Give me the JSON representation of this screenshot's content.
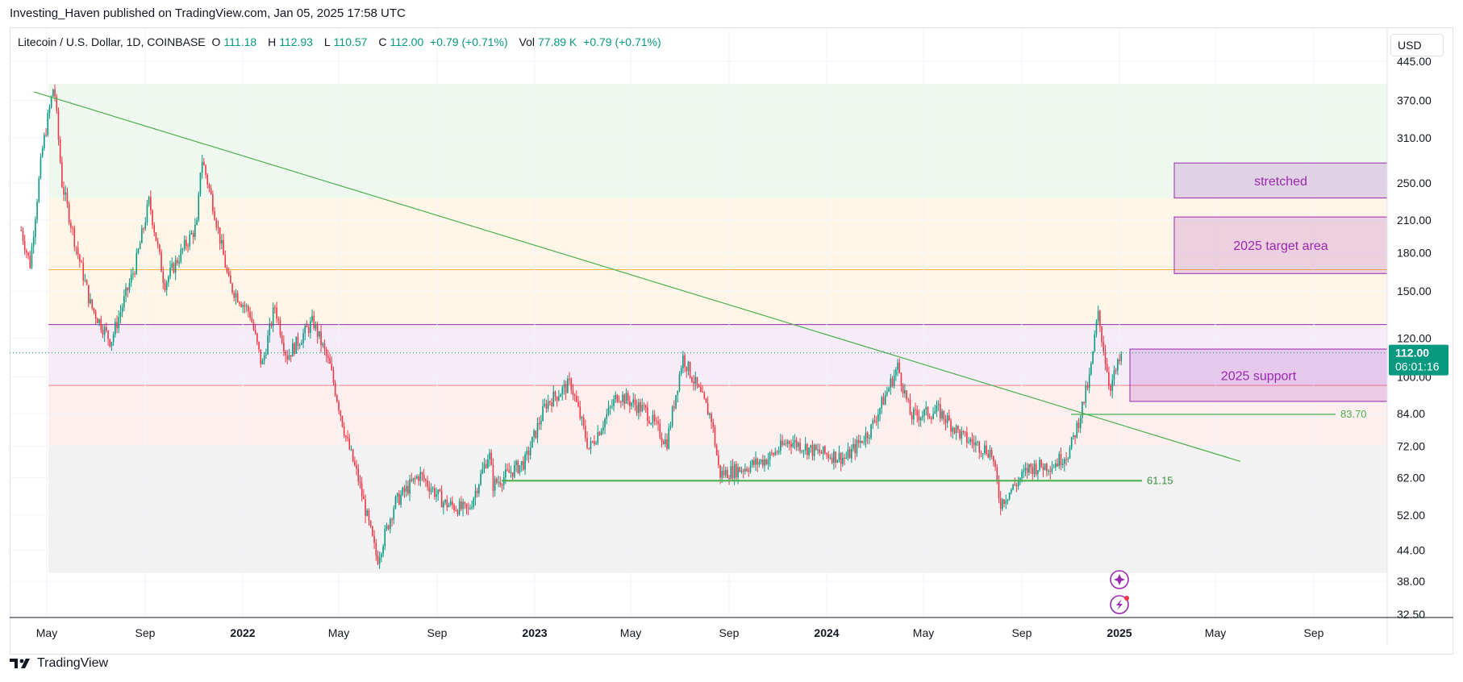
{
  "header": {
    "published_by": "Investing_Haven published on TradingView.com, Jan 05, 2025 17:58 UTC"
  },
  "legend": {
    "symbol": "Litecoin / U.S. Dollar, 1D, COINBASE",
    "open_label": "O",
    "open": "111.18",
    "high_label": "H",
    "high": "112.93",
    "low_label": "L",
    "low": "110.57",
    "close_label": "C",
    "close": "112.00",
    "change": "+0.79 (+0.71%)",
    "vol_label": "Vol",
    "vol": "77.89 K",
    "vol_change": "+0.79 (+0.71%)"
  },
  "currency_button": "USD",
  "footer": {
    "brand": "TradingView"
  },
  "colors": {
    "up": "#089981",
    "down": "#f23645",
    "trendline": "#4caf50",
    "support_line": "#4caf50",
    "box_border": "#9c27b0",
    "box_text": "#9c27b0",
    "price_badge": "#089981"
  },
  "chart_data": {
    "type": "candlestick",
    "scale": "log",
    "y_ticks": [
      "445.00",
      "370.00",
      "310.00",
      "250.00",
      "210.00",
      "180.00",
      "150.00",
      "120.00",
      "100.00",
      "84.00",
      "72.00",
      "62.00",
      "52.00",
      "44.00",
      "38.00",
      "32.50"
    ],
    "x_ticks": [
      "May",
      "Sep",
      "2022",
      "May",
      "Sep",
      "2023",
      "May",
      "Sep",
      "2024",
      "May",
      "Sep",
      "2025",
      "May",
      "Sep"
    ],
    "price_badge": {
      "price": "112.00",
      "countdown": "06:01:16"
    },
    "levels": [
      {
        "label": "83.70",
        "value": 83.7
      },
      {
        "label": "61.15",
        "value": 61.15
      }
    ],
    "zones": [
      {
        "label": "stretched",
        "low": 233,
        "high": 275
      },
      {
        "label": "2025 target area",
        "low": 163,
        "high": 213
      },
      {
        "label": "2025 support",
        "low": 89,
        "high": 114
      }
    ],
    "trendline": {
      "from": [
        "2021-04-15",
        385
      ],
      "to": [
        "2025-06-01",
        67
      ]
    },
    "price_path": [
      [
        "2021-03-30",
        200
      ],
      [
        "2021-04-10",
        170
      ],
      [
        "2021-04-25",
        290
      ],
      [
        "2021-05-10",
        400
      ],
      [
        "2021-05-20",
        250
      ],
      [
        "2021-06-05",
        190
      ],
      [
        "2021-06-25",
        140
      ],
      [
        "2021-07-20",
        118
      ],
      [
        "2021-08-20",
        170
      ],
      [
        "2021-09-06",
        230
      ],
      [
        "2021-09-25",
        155
      ],
      [
        "2021-10-20",
        185
      ],
      [
        "2021-11-05",
        205
      ],
      [
        "2021-11-10",
        285
      ],
      [
        "2021-11-25",
        225
      ],
      [
        "2021-12-15",
        155
      ],
      [
        "2022-01-10",
        135
      ],
      [
        "2022-01-25",
        105
      ],
      [
        "2022-02-10",
        140
      ],
      [
        "2022-02-25",
        110
      ],
      [
        "2022-03-30",
        130
      ],
      [
        "2022-04-20",
        105
      ],
      [
        "2022-05-10",
        75
      ],
      [
        "2022-05-25",
        62
      ],
      [
        "2022-06-18",
        42
      ],
      [
        "2022-07-10",
        55
      ],
      [
        "2022-08-10",
        63
      ],
      [
        "2022-09-10",
        55
      ],
      [
        "2022-10-10",
        53
      ],
      [
        "2022-11-05",
        70
      ],
      [
        "2022-11-10",
        60
      ],
      [
        "2022-12-20",
        67
      ],
      [
        "2023-01-15",
        88
      ],
      [
        "2023-02-15",
        97
      ],
      [
        "2023-03-10",
        71
      ],
      [
        "2023-04-15",
        92
      ],
      [
        "2023-05-20",
        85
      ],
      [
        "2023-06-15",
        73
      ],
      [
        "2023-07-05",
        110
      ],
      [
        "2023-08-10",
        82
      ],
      [
        "2023-08-20",
        63
      ],
      [
        "2023-09-20",
        65
      ],
      [
        "2023-10-20",
        68
      ],
      [
        "2023-11-15",
        74
      ],
      [
        "2023-12-20",
        70
      ],
      [
        "2024-01-25",
        68
      ],
      [
        "2024-02-25",
        78
      ],
      [
        "2024-03-30",
        105
      ],
      [
        "2024-04-15",
        83
      ],
      [
        "2024-05-20",
        85
      ],
      [
        "2024-06-20",
        75
      ],
      [
        "2024-07-25",
        70
      ],
      [
        "2024-08-05",
        55
      ],
      [
        "2024-09-10",
        65
      ],
      [
        "2024-10-10",
        66
      ],
      [
        "2024-10-30",
        70
      ],
      [
        "2024-11-10",
        80
      ],
      [
        "2024-11-25",
        100
      ],
      [
        "2024-12-05",
        135
      ],
      [
        "2024-12-20",
        95
      ],
      [
        "2025-01-05",
        112
      ]
    ]
  }
}
